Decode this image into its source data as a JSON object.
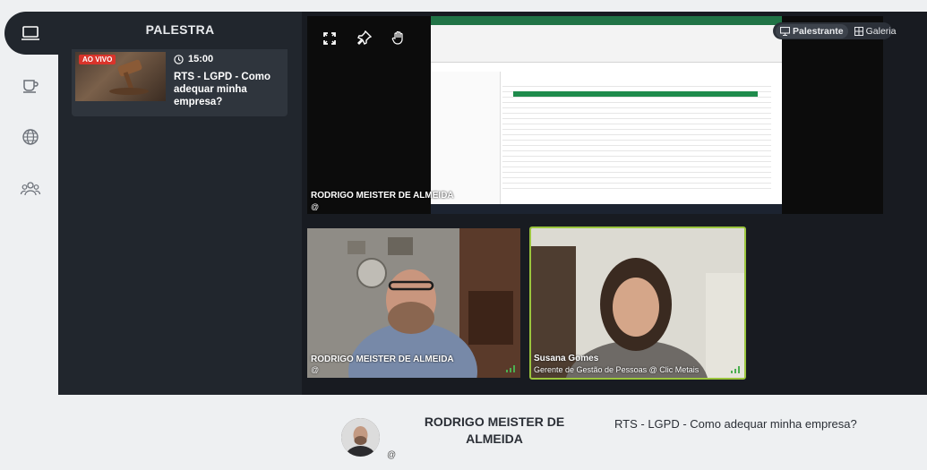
{
  "sidebar": {
    "title": "PALESTRA",
    "items": [
      {
        "name": "stage",
        "icon": "laptop-icon"
      },
      {
        "name": "lounge",
        "icon": "coffee-cup-icon"
      },
      {
        "name": "web",
        "icon": "globe-icon"
      },
      {
        "name": "people",
        "icon": "people-icon"
      }
    ]
  },
  "talk": {
    "live_badge": "AO VIVO",
    "time": "15:00",
    "title": "RTS - LGPD - Como adequar minha empresa?"
  },
  "view_toggle": {
    "speaker_label": "Palestrante",
    "gallery_label": "Galeria"
  },
  "tiles": [
    {
      "name": "RODRIGO MEISTER DE ALMEIDA",
      "subtitle": "@"
    },
    {
      "name": "RODRIGO MEISTER DE ALMEIDA",
      "subtitle": "@"
    },
    {
      "name": "Susana Gomes",
      "subtitle": "Gerente de Gestão de Pessoas @ Clic Metais"
    }
  ],
  "footer": {
    "speaker_name": "RODRIGO MEISTER DE ALMEIDA",
    "speaker_at": "@",
    "talk_title": "RTS - LGPD - Como adequar minha empresa?"
  },
  "colors": {
    "active_speaker_border": "#9bc53d",
    "live_badge": "#d9342b",
    "panel_bg": "#21262d"
  }
}
